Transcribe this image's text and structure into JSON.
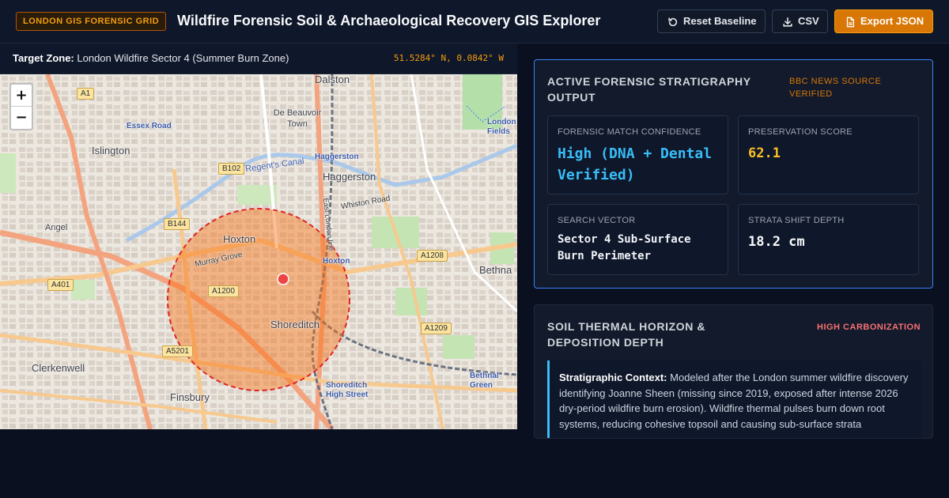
{
  "header": {
    "badge": "LONDON GIS FORENSIC GRID",
    "title": "Wildfire Forensic Soil & Archaeological Recovery GIS Explorer",
    "buttons": {
      "reset": "Reset Baseline",
      "csv": "CSV",
      "export": "Export JSON"
    }
  },
  "map_header": {
    "target_label": "Target Zone:",
    "target_value": "London Wildfire Sector 4 (Summer Burn Zone)",
    "coordinates": "51.5284° N, 0.0842° W"
  },
  "map": {
    "zoom_in": "+",
    "zoom_out": "−",
    "places": [
      "Dalston",
      "De Beauvoir Town",
      "Haggerston",
      "Islington",
      "Angel",
      "Hoxton",
      "Shoreditch",
      "Clerkenwell",
      "Finsbury",
      "Bethnal Green",
      "London Fields"
    ],
    "streets": [
      "Essex Road",
      "Regent's Canal",
      "Whiston Road",
      "Murray Grove",
      "East London line"
    ],
    "stations": [
      "Haggerston",
      "Hoxton",
      "Shoreditch High Street",
      "Bethnal Green",
      "London Fields"
    ],
    "roads": [
      "A1",
      "B102",
      "B144",
      "A401",
      "A1200",
      "A5201",
      "A1208",
      "A1209"
    ],
    "fragment": "Bethna",
    "colors": {
      "burn_zone": "#f97316",
      "burn_border": "#dc2626",
      "marker": "#ef4444"
    }
  },
  "stratigraphy": {
    "title": "ACTIVE FORENSIC STRATIGRAPHY OUTPUT",
    "tag": "BBC NEWS SOURCE VERIFIED",
    "cards": [
      {
        "label": "FORENSIC MATCH CONFIDENCE",
        "value": "High (DNA + Dental Verified)"
      },
      {
        "label": "PRESERVATION SCORE",
        "value": "62.1"
      },
      {
        "label": "SEARCH VECTOR",
        "value": "Sector 4 Sub-Surface Burn Perimeter"
      },
      {
        "label": "STRATA SHIFT DEPTH",
        "value": "18.2 cm"
      }
    ]
  },
  "soil": {
    "title": "SOIL THERMAL HORIZON & DEPOSITION DEPTH",
    "tag": "HIGH CARBONIZATION",
    "context_label": "Stratigraphic Context:",
    "context_text": "Modeled after the London summer wildfire discovery identifying Joanne Sheen (missing since 2019, exposed after intense 2026 dry-period wildfire burn erosion). Wildfire thermal pulses burn down root systems, reducing cohesive topsoil and causing sub-surface strata"
  }
}
